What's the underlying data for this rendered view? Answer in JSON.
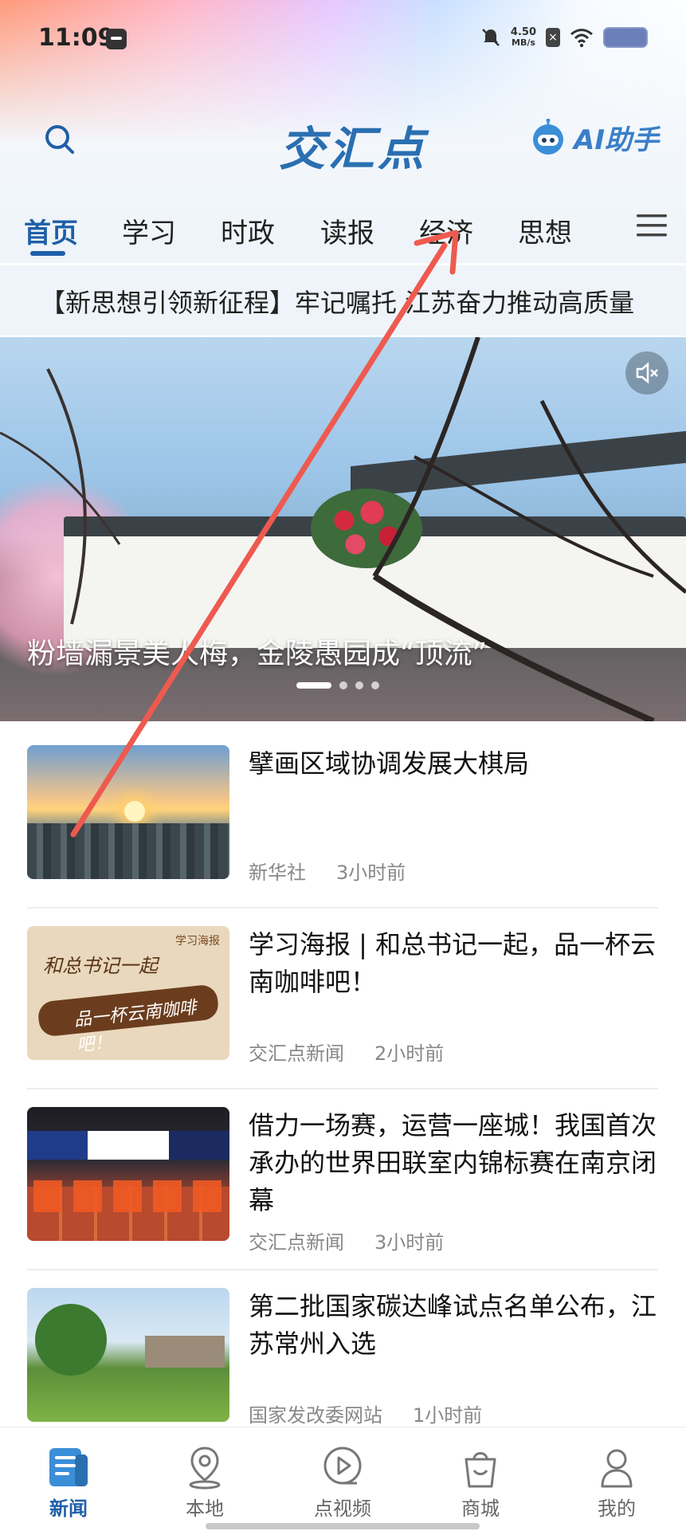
{
  "status_bar": {
    "time": "11:09",
    "net_speed_value": "4.50",
    "net_speed_unit": "MB/s"
  },
  "header": {
    "logo": "交汇点",
    "ai_label": "AI助手"
  },
  "tabs": [
    "首页",
    "学习",
    "时政",
    "读报",
    "经济",
    "思想"
  ],
  "ticker": {
    "text": "【新思想引领新征程】牢记嘱托 江苏奋力推动高质量"
  },
  "hero": {
    "caption": "粉墙漏景美人梅，金陵愚园成“顶流”"
  },
  "news": [
    {
      "title": "擘画区域协调发展大棋局",
      "source": "新华社",
      "time": "3小时前"
    },
    {
      "title": "学习海报 | 和总书记一起，品一杯云南咖啡吧！",
      "source": "交汇点新闻",
      "time": "2小时前"
    },
    {
      "title": "借力一场赛，运营一座城！我国首次承办的世界田联室内锦标赛在南京闭幕",
      "source": "交汇点新闻",
      "time": "3小时前"
    },
    {
      "title": "第二批国家碳达峰试点名单公布，江苏常州入选",
      "source": "国家发改委网站",
      "time": "1小时前"
    }
  ],
  "thumb2_text": {
    "line1": "和总书记一起",
    "line2": "品一杯云南咖啡吧！",
    "tag": "学习海报"
  },
  "bottom_nav": [
    {
      "label": "新闻",
      "icon": "news-icon"
    },
    {
      "label": "本地",
      "icon": "location-icon"
    },
    {
      "label": "点视频",
      "icon": "play-icon"
    },
    {
      "label": "商城",
      "icon": "shopping-bag-icon"
    },
    {
      "label": "我的",
      "icon": "profile-icon"
    }
  ],
  "colors": {
    "accent": "#1f5fa8",
    "annotation_arrow": "#ee5a4f"
  }
}
